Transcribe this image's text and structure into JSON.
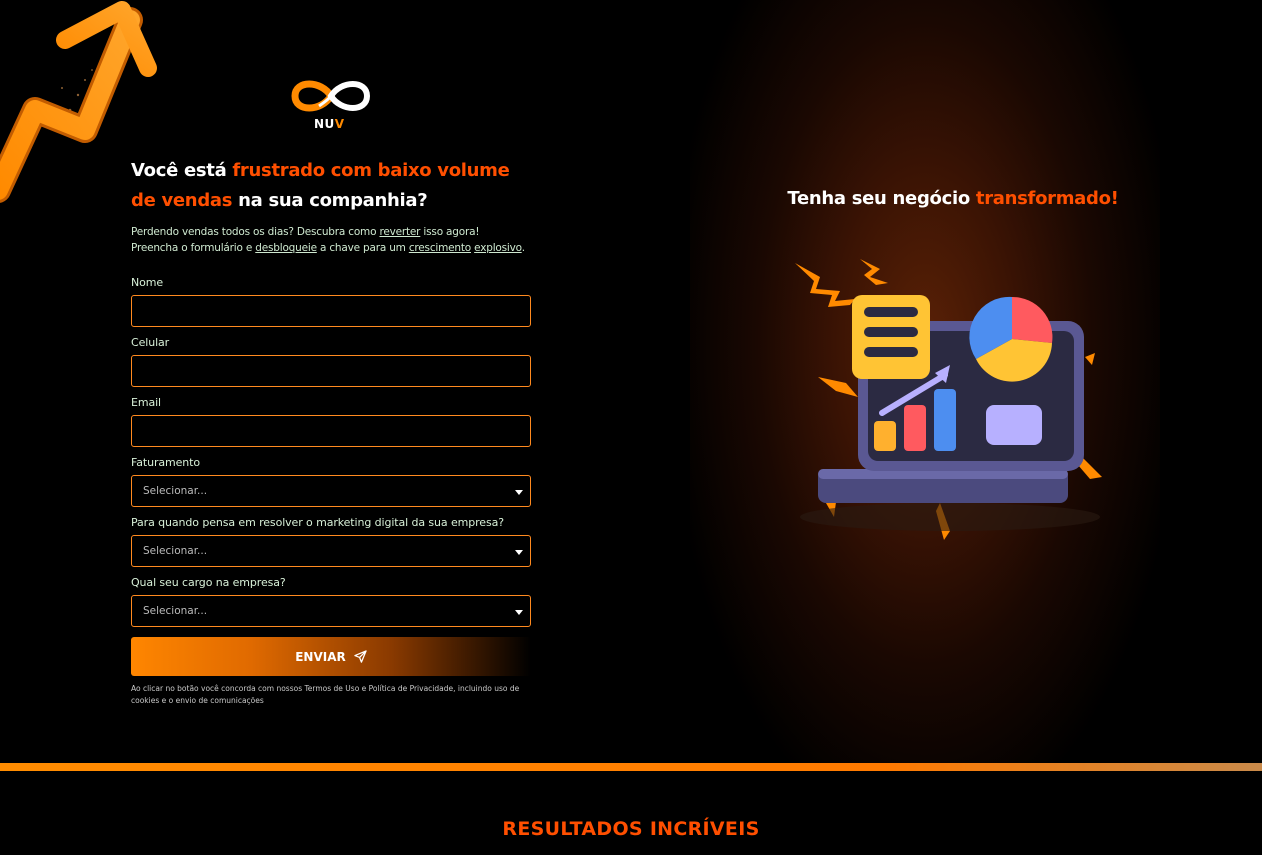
{
  "brand": {
    "logo_text_white": "NU",
    "logo_text_orange": "V"
  },
  "headline": {
    "part1": "Você está ",
    "part2_highlight": "frustrado com baixo volume de vendas",
    "part3": " na sua companhia?"
  },
  "subtext": {
    "line1_a": "Perdendo vendas todos os dias? Descubra como ",
    "line1_link": "reverter",
    "line1_b": " isso agora!",
    "line2_a": "Preencha o formulário e ",
    "line2_link1": "desbloqueie",
    "line2_b": " a chave para um ",
    "line2_link2": "crescimento",
    "line2_c": " ",
    "line2_link3": "explosivo",
    "line2_d": "."
  },
  "form": {
    "name_label": "Nome",
    "phone_label": "Celular",
    "email_label": "Email",
    "revenue_label": "Faturamento",
    "revenue_value": "Selecionar...",
    "timeline_label": "Para quando pensa em resolver o marketing digital da sua empresa?",
    "timeline_value": "Selecionar...",
    "role_label": "Qual seu cargo na empresa?",
    "role_value": "Selecionar...",
    "submit_label": "ENVIAR",
    "legal": "Ao clicar no botão você concorda com nossos Termos de Uso e Política de Privacidade, incluindo uso de cookies e o envio de comunicações"
  },
  "right": {
    "title_a": "Tenha seu negócio ",
    "title_highlight": "transformado!"
  },
  "section": {
    "title": "RESULTADOS INCRÍVEIS"
  },
  "colors": {
    "accent": "#ff4f00",
    "orange": "#ff8a00",
    "background": "#000000"
  }
}
